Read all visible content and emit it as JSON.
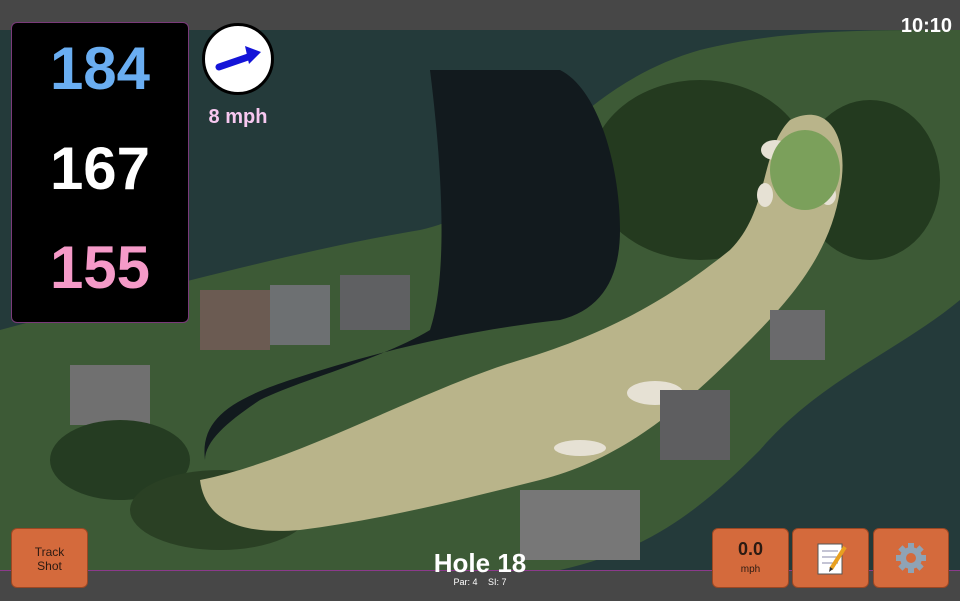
{
  "status": {
    "clock": "10:10"
  },
  "yardage": {
    "back": "184",
    "middle": "167",
    "front": "155"
  },
  "wind": {
    "speed": "8 mph",
    "direction_icon": "wind-arrow-icon"
  },
  "hole": {
    "title": "Hole 18",
    "par": "Par: 4",
    "si": "SI: 7"
  },
  "buttons": {
    "track_line1": "Track",
    "track_line2": "Shot",
    "speed_value": "0.0",
    "speed_unit": "mph",
    "notes_icon": "notepad-icon",
    "settings_icon": "gear-icon"
  },
  "colors": {
    "back_yardage": "#6aaef2",
    "middle_yardage": "#ffffff",
    "front_yardage": "#f59ac8",
    "wind_text": "#f7c8f0",
    "button_fill": "#d46a3c",
    "bar_border": "#8c3a8c"
  }
}
